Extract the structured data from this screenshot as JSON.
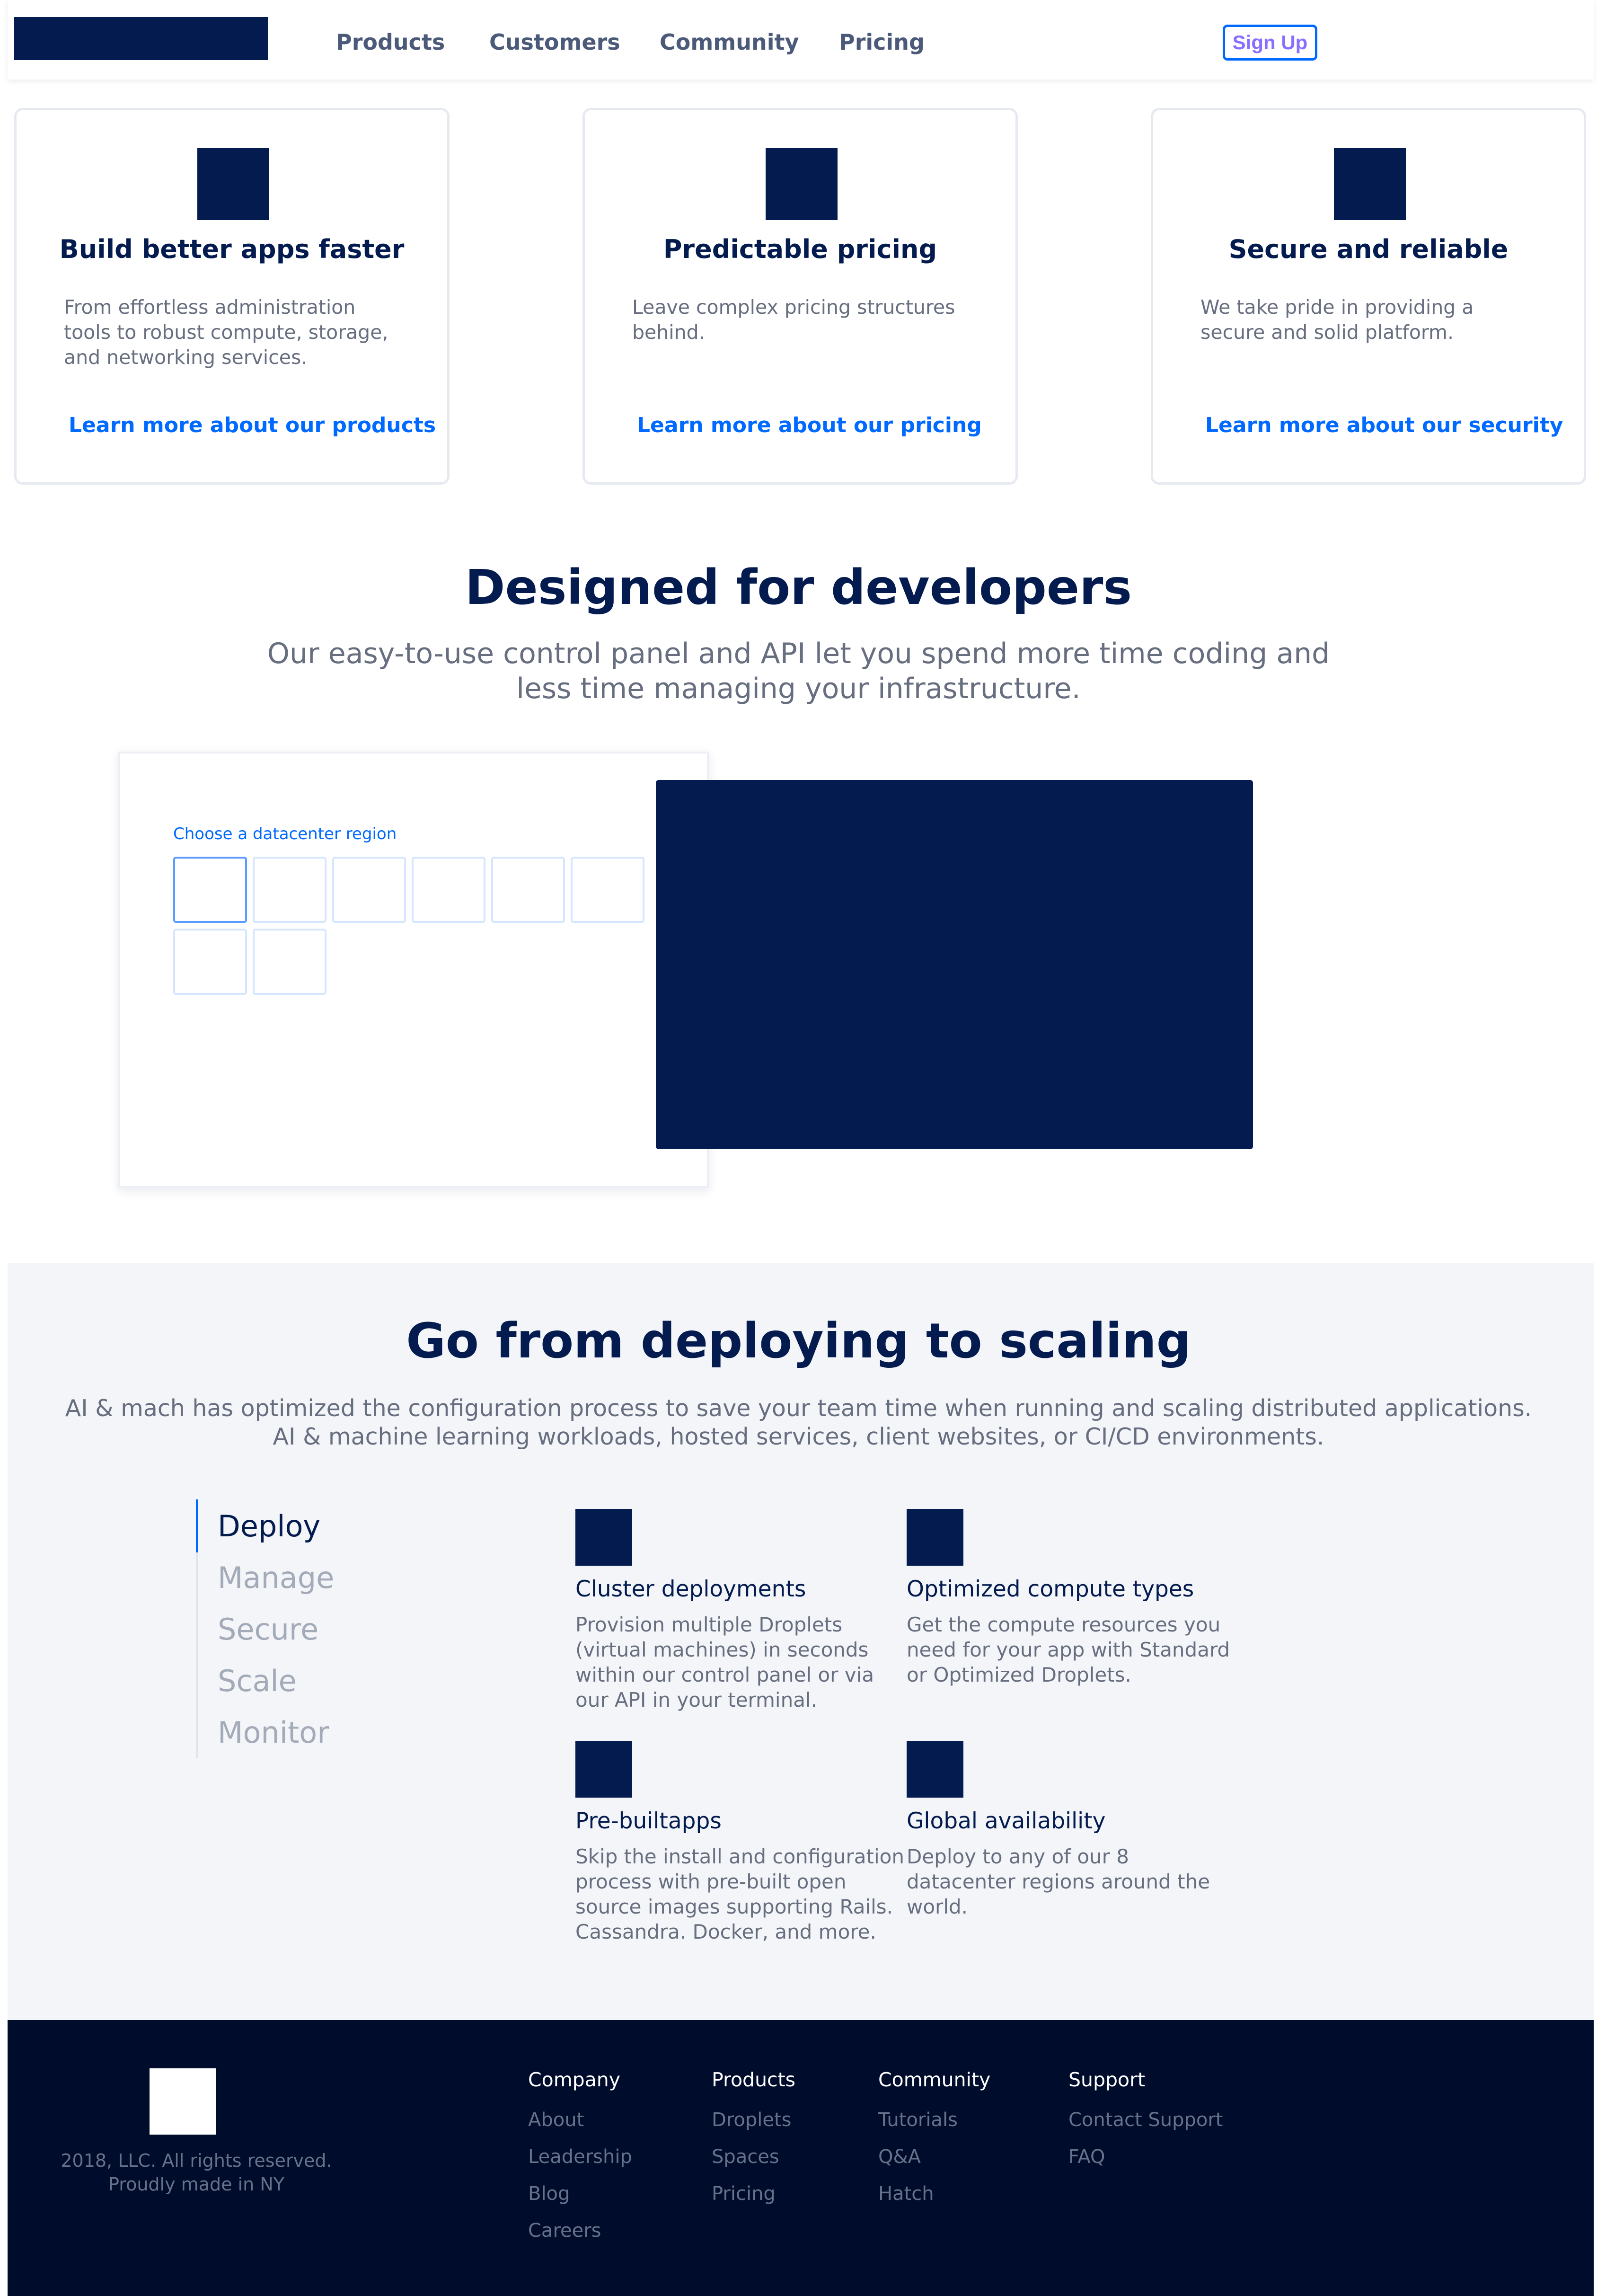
{
  "nav": {
    "links": [
      "Products",
      "Customers",
      "Community",
      "Pricing"
    ],
    "signup_label": "Sign Up"
  },
  "cards": [
    {
      "title": "Build better apps faster",
      "desc": "From effortless administration tools to robust compute, storage, and networking services.",
      "link": "Learn more about our products"
    },
    {
      "title": "Predictable pricing",
      "desc": "Leave complex pricing structures behind.",
      "link": "Learn more about our pricing"
    },
    {
      "title": "Secure and reliable",
      "desc": "We take pride in providing a secure and solid platform.",
      "link": "Learn more about our security"
    }
  ],
  "developers": {
    "title": "Designed for developers",
    "subtitle": "Our easy-to-use control panel and API let you spend more time coding and less time managing your infrastructure.",
    "panel_label": "Choose a datacenter region"
  },
  "scaling": {
    "title": "Go from deploying to scaling",
    "subtitle": "AI & mach has optimized the configuration process to save your team time when running and scaling distributed applications. AI & machine learning workloads, hosted services, client websites, or CI/CD environments.",
    "tabs": [
      "Deploy",
      "Manage",
      "Secure",
      "Scale",
      "Monitor"
    ],
    "features": [
      {
        "title": "Cluster deployments",
        "desc": "Provision multiple Droplets (virtual machines) in seconds within our control panel or via our API in your terminal."
      },
      {
        "title": "Optimized compute types",
        "desc": "Get the compute resources you need for your app with Standard or Optimized Droplets."
      },
      {
        "title": "Pre-builtapps",
        "desc": "Skip the install and configuration process with pre-built open source images supporting Rails. Cassandra. Docker, and more."
      },
      {
        "title": "Global availability",
        "desc": "Deploy to any of our 8 datacenter regions around the world."
      }
    ]
  },
  "footer": {
    "copyright_line1": "2018, LLC. All rights reserved.",
    "copyright_line2": "Proudly made in NY",
    "columns": [
      {
        "heading": "Company",
        "links": [
          "About",
          "Leadership",
          "Blog",
          "Careers"
        ]
      },
      {
        "heading": "Products",
        "links": [
          "Droplets",
          "Spaces",
          "Pricing"
        ]
      },
      {
        "heading": "Community",
        "links": [
          "Tutorials",
          "Q&A",
          "Hatch"
        ]
      },
      {
        "heading": "Support",
        "links": [
          "Contact Support",
          "FAQ"
        ]
      }
    ]
  }
}
